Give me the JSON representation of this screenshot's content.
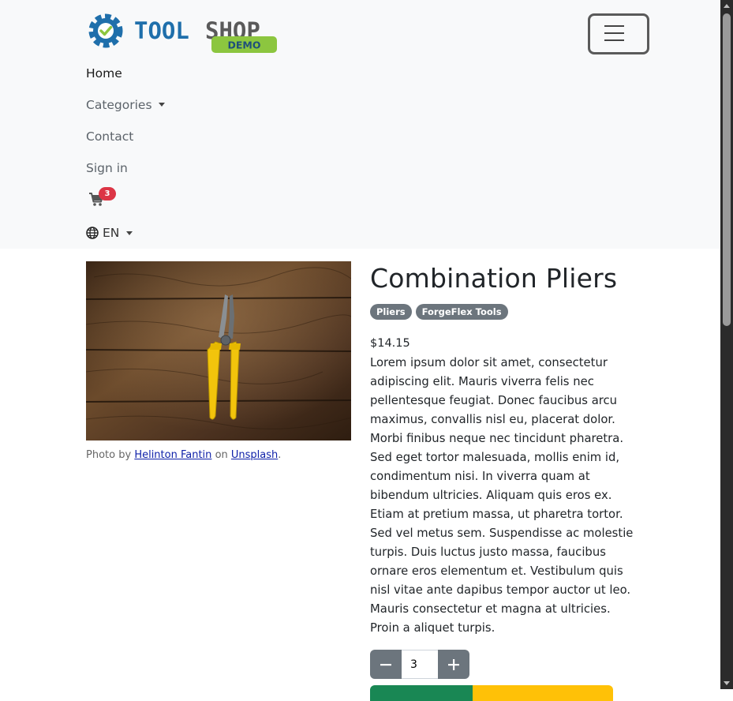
{
  "brand": {
    "logo_text": "TOOLSHOP",
    "logo_badge": "DEMO"
  },
  "nav": {
    "home": "Home",
    "categories": "Categories",
    "contact": "Contact",
    "sign_in": "Sign in",
    "cart_count": "3",
    "language": "EN"
  },
  "product": {
    "title": "Combination Pliers",
    "tags": [
      "Pliers",
      "ForgeFlex Tools"
    ],
    "price": "$14.15",
    "description": "Lorem ipsum dolor sit amet, consectetur adipiscing elit. Mauris viverra felis nec pellentesque feugiat. Donec faucibus arcu maximus, convallis nisl eu, placerat dolor. Morbi finibus neque nec tincidunt pharetra. Sed eget tortor malesuada, mollis enim id, condimentum nisi. In viverra quam at bibendum ultricies. Aliquam quis eros ex. Etiam at pretium massa, ut pharetra tortor. Sed vel metus sem. Suspendisse ac molestie turpis. Duis luctus justo massa, faucibus ornare eros elementum et. Vestibulum quis nisl vitae ante dapibus tempor auctor ut leo. Mauris consectetur et magna at ultricies. Proin a aliquet turpis.",
    "quantity": "3",
    "photo_credit": {
      "prefix": "Photo by",
      "author": "Helinton Fantin",
      "middle": "on",
      "source": "Unsplash",
      "suffix": "."
    }
  },
  "colors": {
    "brand_blue": "#1f6fab",
    "brand_green": "#8cc63f",
    "badge_gray": "#6c757d",
    "cart_badge_red": "#dc3545",
    "add_to_cart_green": "#198754",
    "favorite_yellow": "#ffc107"
  }
}
